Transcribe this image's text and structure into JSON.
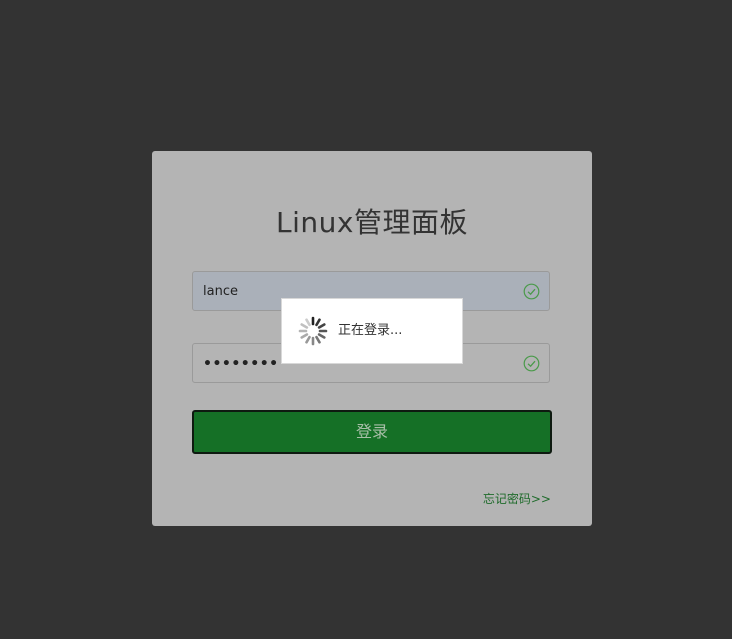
{
  "login": {
    "title": "Linux管理面板",
    "username_value": "lance",
    "password_value": "••••••••",
    "submit_label": "登录",
    "forgot_label": "忘记密码>>"
  },
  "loading": {
    "text": "正在登录..."
  },
  "colors": {
    "background": "#333333",
    "card": "#b4b4b4",
    "button": "#157026",
    "link": "#1f6b2b",
    "valid_check": "#4a9a4a"
  },
  "icons": {
    "username_status": "check-circle-icon",
    "password_status": "check-circle-icon",
    "loading": "spinner-icon"
  }
}
